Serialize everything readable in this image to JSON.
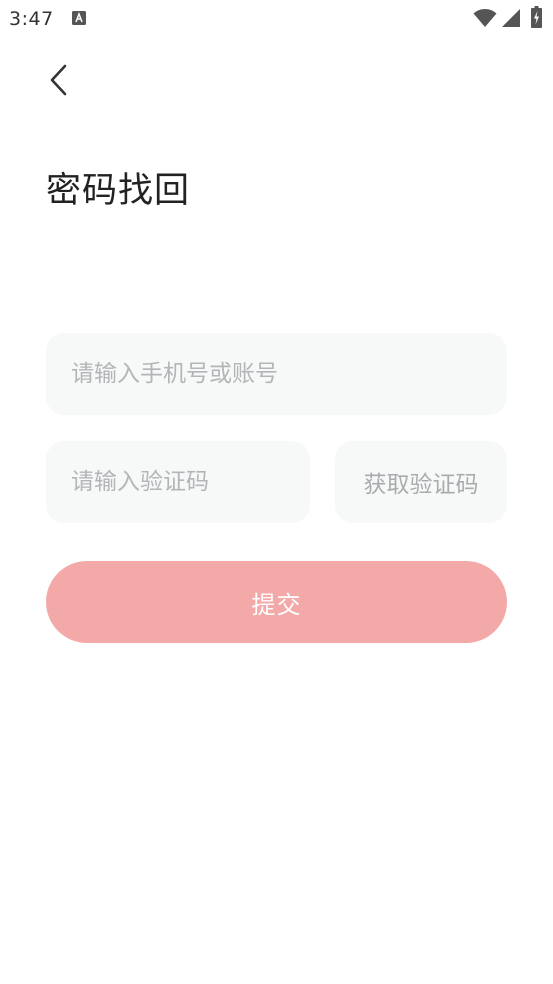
{
  "status_bar": {
    "time": "3:47",
    "icons": [
      "a-notification-icon",
      "wifi-icon",
      "cell-signal-icon",
      "battery-charging-icon"
    ]
  },
  "header": {
    "back_icon": "chevron-left-icon",
    "title": "密码找回"
  },
  "form": {
    "account_placeholder": "请输入手机号或账号",
    "account_value": "",
    "code_placeholder": "请输入验证码",
    "code_value": "",
    "get_code_label": "获取验证码",
    "submit_label": "提交"
  },
  "colors": {
    "submit_bg": "#f4a9a9",
    "field_bg": "#f7f9f8",
    "placeholder": "#b3b5b8",
    "title": "#222222"
  }
}
